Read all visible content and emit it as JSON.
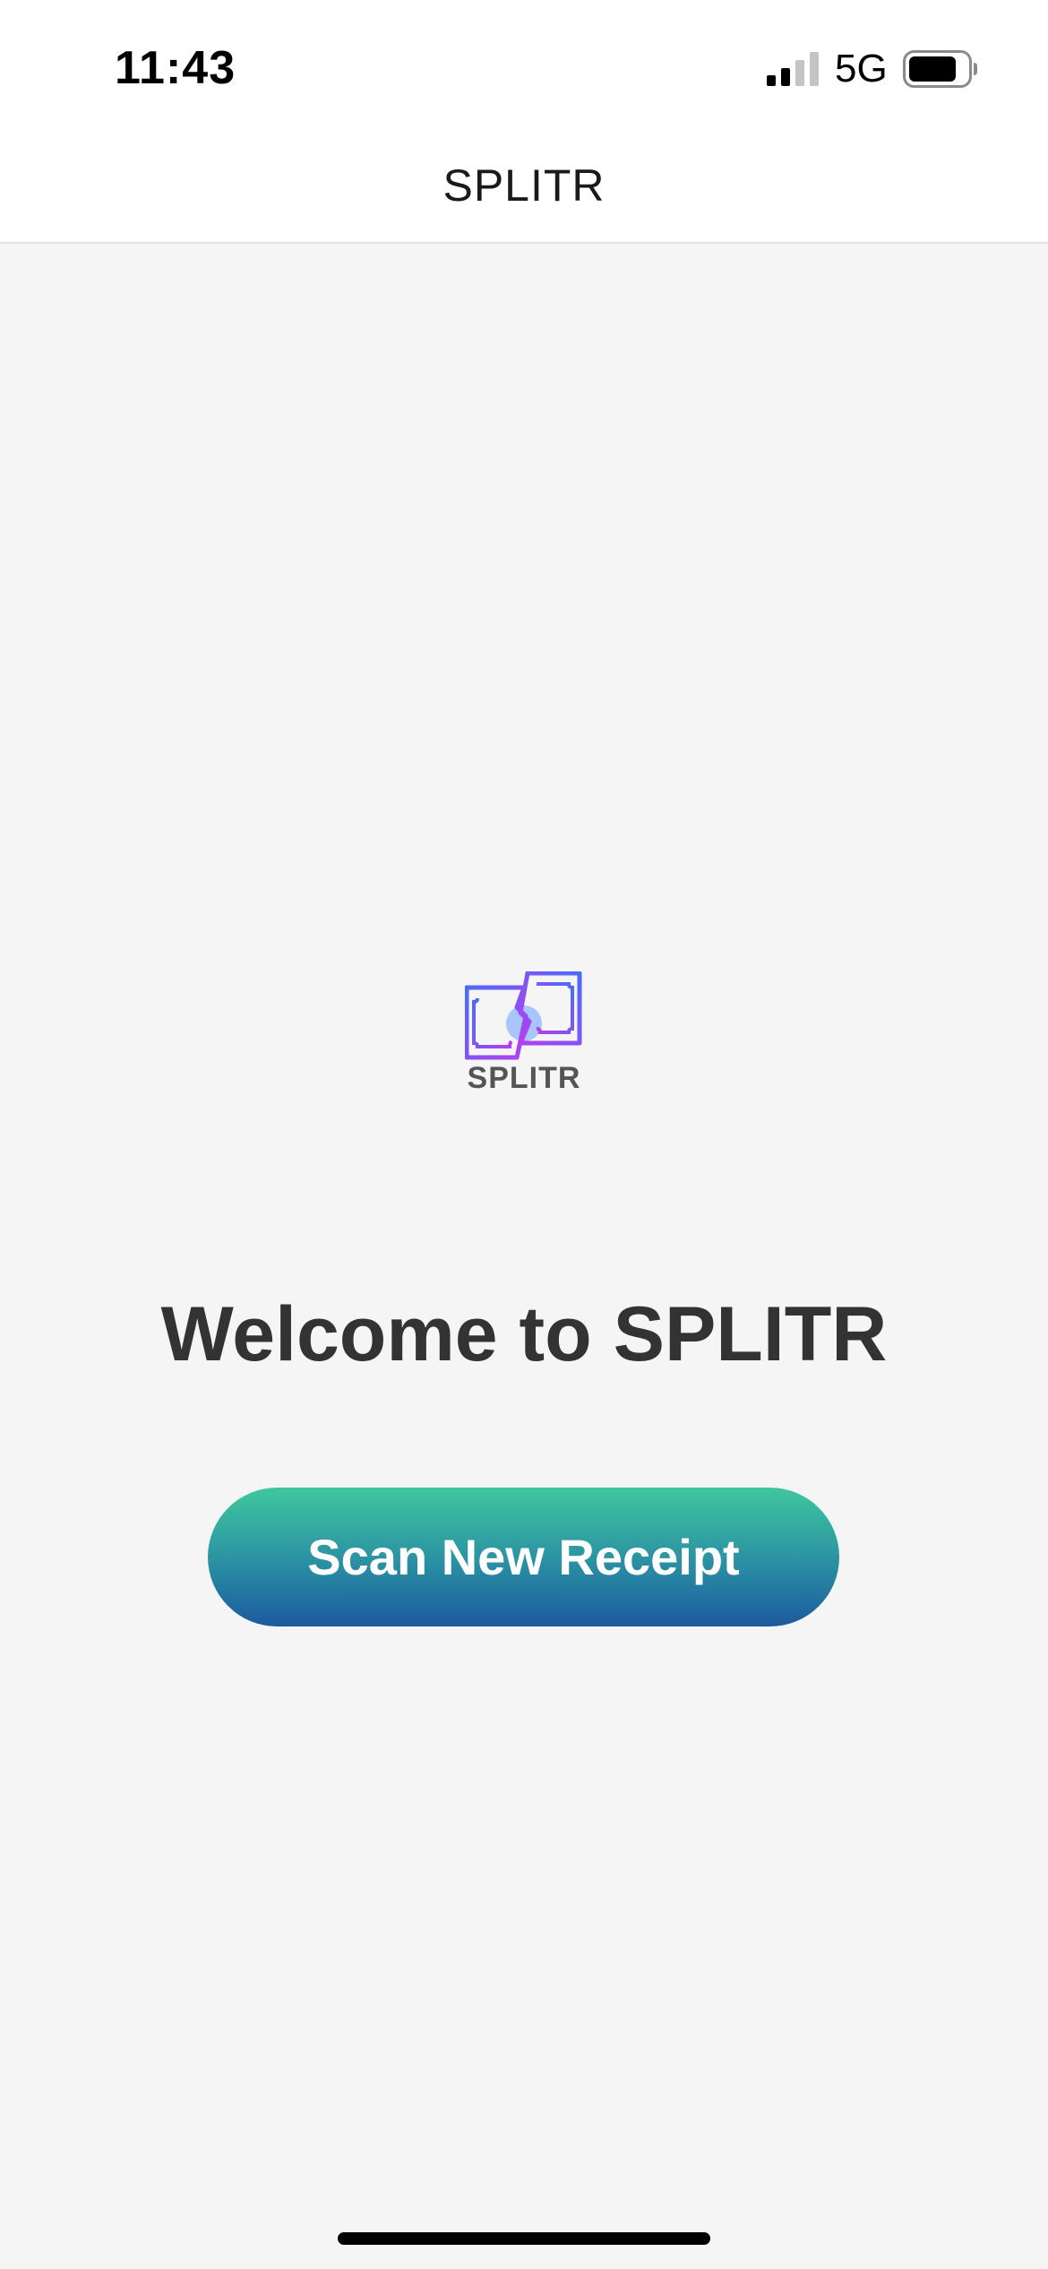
{
  "status_bar": {
    "time": "11:43",
    "network": "5G",
    "signal_icon": "cellular-signal-icon",
    "battery_icon": "battery-icon",
    "signal_bars_active": 2,
    "signal_bars_total": 4,
    "battery_level": 0.8
  },
  "nav": {
    "title": "SPLITR"
  },
  "logo": {
    "icon": "split-receipt-logo-icon",
    "text": "SPLITR",
    "colors": {
      "blue": "#4a6cf7",
      "purple": "#b63ef0",
      "accent_dot": "#8fb4ff"
    }
  },
  "main": {
    "welcome": "Welcome to SPLITR",
    "scan_button_label": "Scan New Receipt"
  },
  "colors": {
    "background": "#f5f5f5",
    "button_gradient_top": "#3fc79e",
    "button_gradient_bottom": "#1c5a9e",
    "title_text": "#333333"
  }
}
